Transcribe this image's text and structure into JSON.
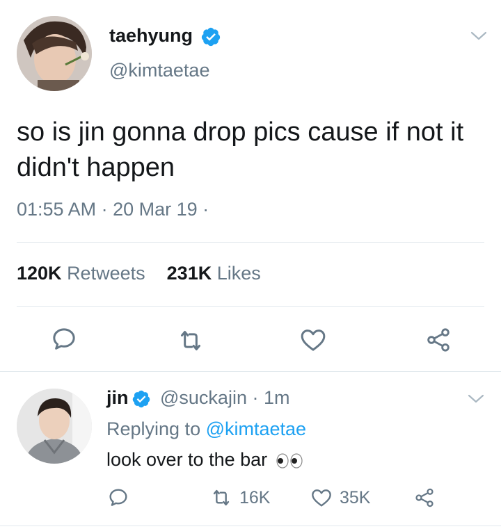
{
  "tweet": {
    "display_name": "taehyung",
    "handle": "@kimtaetae",
    "text": "so is jin gonna drop pics cause if not it didn't happen",
    "meta": "01:55 AM · 20 Mar 19 ·",
    "retweets_count": "120K",
    "retweets_label": "Retweets",
    "likes_count": "231K",
    "likes_label": "Likes"
  },
  "reply": {
    "display_name": "jin",
    "handle_time": "@suckajin · 1m",
    "replying_prefix": "Replying to",
    "replying_mention": "@kimtaetae",
    "text": "look over to the bar",
    "retweet_count": "16K",
    "like_count": "35K"
  },
  "colors": {
    "verified_blue": "#1da1f2",
    "secondary_text": "#657786",
    "divider": "#e1e8ed"
  }
}
